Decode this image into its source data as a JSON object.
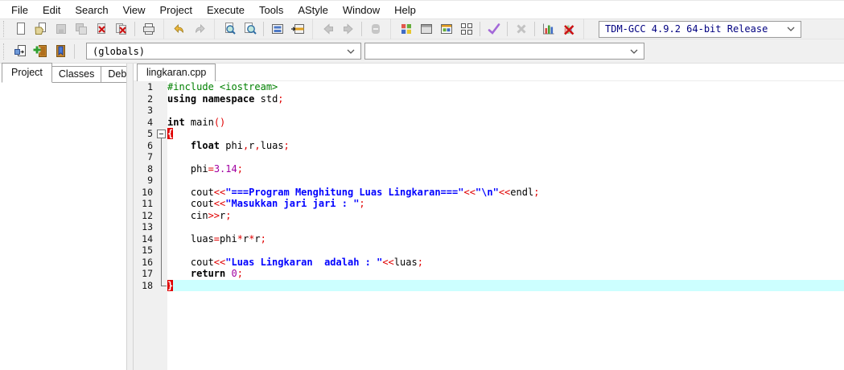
{
  "menu": {
    "items": [
      "File",
      "Edit",
      "Search",
      "View",
      "Project",
      "Execute",
      "Tools",
      "AStyle",
      "Window",
      "Help"
    ]
  },
  "toolbar": {
    "icons": [
      "new-file",
      "open-file",
      "save",
      "save-all",
      "close-file",
      "close-all",
      "print",
      "undo",
      "redo",
      "find",
      "replace",
      "goto-function",
      "goto-line",
      "nav-back",
      "nav-forward",
      "pause",
      "compile",
      "run",
      "compile-and-run",
      "rebuild-all",
      "syntax-check",
      "abort-compilation",
      "profile-analysis",
      "delete-profiling-data"
    ],
    "disabled_icons": [
      "save",
      "save-all",
      "redo",
      "nav-back",
      "nav-forward",
      "pause",
      "abort-compilation"
    ],
    "compiler_select": "TDM-GCC 4.9.2 64-bit Release"
  },
  "toolbar2": {
    "icons": [
      "new-unit",
      "add-to-project",
      "remove-from-project"
    ],
    "globals_value": "(globals)",
    "members_value": ""
  },
  "left_panel": {
    "tabs": [
      "Project",
      "Classes",
      "Debug"
    ],
    "active_tab": "Project"
  },
  "editor": {
    "tab": "lingkaran.cpp",
    "lines": [
      {
        "n": 1,
        "fold": "none",
        "segs": [
          {
            "t": "#include <iostream>",
            "c": "pre"
          }
        ]
      },
      {
        "n": 2,
        "fold": "none",
        "segs": [
          {
            "t": "using",
            "c": "kw"
          },
          {
            "t": " ",
            "c": "pl"
          },
          {
            "t": "namespace",
            "c": "kw"
          },
          {
            "t": " std",
            "c": "pl"
          },
          {
            "t": ";",
            "c": "op"
          }
        ]
      },
      {
        "n": 3,
        "fold": "none",
        "segs": []
      },
      {
        "n": 4,
        "fold": "none",
        "segs": [
          {
            "t": "int",
            "c": "kw"
          },
          {
            "t": " main",
            "c": "pl"
          },
          {
            "t": "()",
            "c": "op"
          }
        ]
      },
      {
        "n": 5,
        "fold": "open",
        "segs": [
          {
            "t": "{",
            "c": "brace"
          }
        ]
      },
      {
        "n": 6,
        "fold": "line",
        "segs": [
          {
            "t": "    ",
            "c": "pl"
          },
          {
            "t": "float",
            "c": "kw"
          },
          {
            "t": " phi",
            "c": "pl"
          },
          {
            "t": ",",
            "c": "op"
          },
          {
            "t": "r",
            "c": "pl"
          },
          {
            "t": ",",
            "c": "op"
          },
          {
            "t": "luas",
            "c": "pl"
          },
          {
            "t": ";",
            "c": "op"
          }
        ]
      },
      {
        "n": 7,
        "fold": "line",
        "segs": []
      },
      {
        "n": 8,
        "fold": "line",
        "segs": [
          {
            "t": "    phi",
            "c": "pl"
          },
          {
            "t": "=",
            "c": "op"
          },
          {
            "t": "3.14",
            "c": "num"
          },
          {
            "t": ";",
            "c": "op"
          }
        ]
      },
      {
        "n": 9,
        "fold": "line",
        "segs": []
      },
      {
        "n": 10,
        "fold": "line",
        "segs": [
          {
            "t": "    cout",
            "c": "pl"
          },
          {
            "t": "<<",
            "c": "op"
          },
          {
            "t": "\"===Program Menghitung Luas Lingkaran===\"",
            "c": "str"
          },
          {
            "t": "<<",
            "c": "op"
          },
          {
            "t": "\"\\n\"",
            "c": "str"
          },
          {
            "t": "<<",
            "c": "op"
          },
          {
            "t": "endl",
            "c": "pl"
          },
          {
            "t": ";",
            "c": "op"
          }
        ]
      },
      {
        "n": 11,
        "fold": "line",
        "segs": [
          {
            "t": "    cout",
            "c": "pl"
          },
          {
            "t": "<<",
            "c": "op"
          },
          {
            "t": "\"Masukkan jari jari : \"",
            "c": "str"
          },
          {
            "t": ";",
            "c": "op"
          }
        ]
      },
      {
        "n": 12,
        "fold": "line",
        "segs": [
          {
            "t": "    cin",
            "c": "pl"
          },
          {
            "t": ">>",
            "c": "op"
          },
          {
            "t": "r",
            "c": "pl"
          },
          {
            "t": ";",
            "c": "op"
          }
        ]
      },
      {
        "n": 13,
        "fold": "line",
        "segs": []
      },
      {
        "n": 14,
        "fold": "line",
        "segs": [
          {
            "t": "    luas",
            "c": "pl"
          },
          {
            "t": "=",
            "c": "op"
          },
          {
            "t": "phi",
            "c": "pl"
          },
          {
            "t": "*",
            "c": "op"
          },
          {
            "t": "r",
            "c": "pl"
          },
          {
            "t": "*",
            "c": "op"
          },
          {
            "t": "r",
            "c": "pl"
          },
          {
            "t": ";",
            "c": "op"
          }
        ]
      },
      {
        "n": 15,
        "fold": "line",
        "segs": []
      },
      {
        "n": 16,
        "fold": "line",
        "segs": [
          {
            "t": "    cout",
            "c": "pl"
          },
          {
            "t": "<<",
            "c": "op"
          },
          {
            "t": "\"Luas Lingkaran  adalah : \"",
            "c": "str"
          },
          {
            "t": "<<",
            "c": "op"
          },
          {
            "t": "luas",
            "c": "pl"
          },
          {
            "t": ";",
            "c": "op"
          }
        ]
      },
      {
        "n": 17,
        "fold": "line",
        "segs": [
          {
            "t": "    ",
            "c": "pl"
          },
          {
            "t": "return",
            "c": "kw"
          },
          {
            "t": " ",
            "c": "pl"
          },
          {
            "t": "0",
            "c": "num"
          },
          {
            "t": ";",
            "c": "op"
          }
        ]
      },
      {
        "n": 18,
        "fold": "end",
        "current": true,
        "segs": [
          {
            "t": "}",
            "c": "brace"
          }
        ]
      }
    ]
  },
  "colors": {
    "preprocessor": "#008000",
    "string": "#0000ff",
    "number": "#a100a1",
    "operator": "#e00000",
    "current-line": "#ccffff",
    "gutter-bg": "#f0f0f0",
    "toolbar-bg": "#f0f0f0",
    "combo-text": "#000080"
  }
}
